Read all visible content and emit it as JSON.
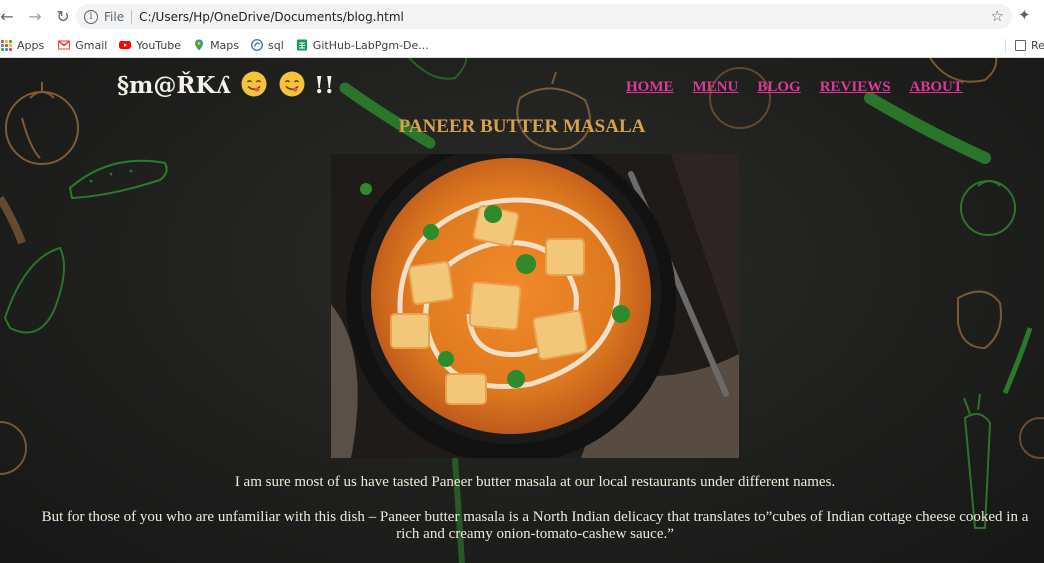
{
  "browser": {
    "url_scheme": "File",
    "url": "C:/Users/Hp/OneDrive/Documents/blog.html",
    "bookmarks": [
      {
        "label": "Apps",
        "icon": "apps-grid-icon"
      },
      {
        "label": "Gmail",
        "icon": "gmail-icon",
        "color": "#ea4335"
      },
      {
        "label": "YouTube",
        "icon": "youtube-icon",
        "color": "#ff0000"
      },
      {
        "label": "Maps",
        "icon": "maps-icon",
        "color": "#34a853"
      },
      {
        "label": "sql",
        "icon": "sql-icon",
        "color": "#3d7ab8"
      },
      {
        "label": "GitHub-LabPgm-De...",
        "icon": "sheets-icon",
        "color": "#0f9d58"
      }
    ],
    "reading_list": "Re"
  },
  "site": {
    "logo_text": "§m@ŘKʎ",
    "logo_suffix": "!!",
    "nav": [
      "HOME",
      "MENU",
      "BLOG",
      "REVIEWS",
      "ABOUT"
    ],
    "nav_color": "#e0389a",
    "title_color": "#d7a24a"
  },
  "article": {
    "title": "PANEER BUTTER MASALA",
    "paragraphs": [
      "I am sure most of us have tasted Paneer butter masala at our local restaurants under different names.",
      "But for those of you who are unfamiliar with this dish – Paneer butter masala is a North Indian delicacy that translates to”cubes of Indian cottage cheese cooked in a rich and creamy onion-tomato-cashew sauce.”"
    ]
  }
}
